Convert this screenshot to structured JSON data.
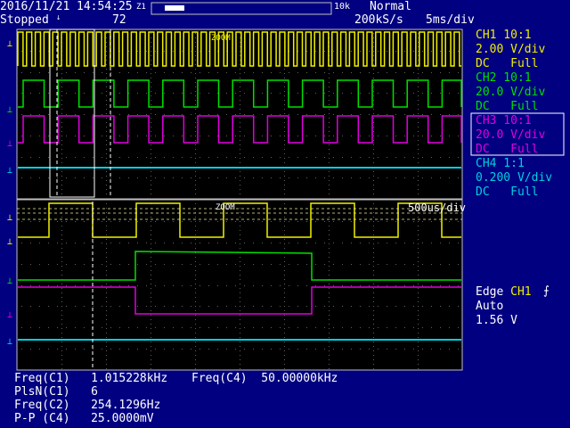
{
  "header": {
    "date": "2016/11/21",
    "time": "14:54:25",
    "zoom_mark": "Z1",
    "record_len": "10k",
    "mode": "Normal",
    "state": "Stopped",
    "acq_count": "72",
    "sample_rate": "200kS/s",
    "timebase": "5ms/div"
  },
  "channels": [
    {
      "name": "CH1 10:1",
      "scale": "2.00 V/div",
      "coupling": "DC",
      "bw": "Full",
      "color": "#f0f000"
    },
    {
      "name": "CH2 10:1",
      "scale": "20.0 V/div",
      "coupling": "DC",
      "bw": "Full",
      "color": "#00e000"
    },
    {
      "name": "CH3 10:1",
      "scale": "20.0 V/div",
      "coupling": "DC",
      "bw": "Full",
      "color": "#e000e0"
    },
    {
      "name": "CH4 1:1",
      "scale": "0.200 V/div",
      "coupling": "DC",
      "bw": "Full",
      "color": "#00d0e0"
    }
  ],
  "trigger": {
    "type": "Edge",
    "source": "CH1",
    "mode": "Auto",
    "level": "1.56 V"
  },
  "zoom": {
    "label": "ZOOM",
    "timebase": "500us/div"
  },
  "top_label": "ZOOM",
  "measurements": [
    {
      "name": "Freq(C1)",
      "value": "1.015228kHz"
    },
    {
      "name": "PlsN(C1)",
      "value": "6"
    },
    {
      "name": "Freq(C2)",
      "value": "254.1296Hz"
    },
    {
      "name": "P-P (C4)",
      "value": "25.0000mV"
    }
  ],
  "measurement_right": {
    "name": "Freq(C4)",
    "value": "50.00000kHz"
  }
}
